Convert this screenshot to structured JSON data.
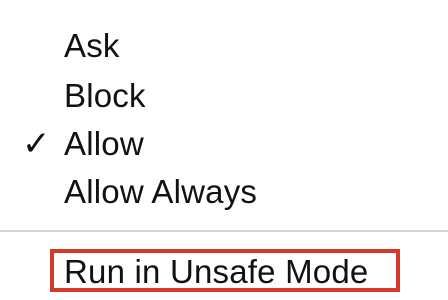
{
  "menu": {
    "items": [
      {
        "label": "Ask",
        "checked": false
      },
      {
        "label": "Block",
        "checked": false
      },
      {
        "label": "Allow",
        "checked": true
      },
      {
        "label": "Allow Always",
        "checked": false
      }
    ],
    "checkmark_glyph": "✓",
    "unsafe_item": {
      "label": "Run in Unsafe Mode"
    }
  },
  "colors": {
    "text": "#111111",
    "separator": "#d6d6d6",
    "highlight": "#d43a2a",
    "background": "#ffffff"
  }
}
